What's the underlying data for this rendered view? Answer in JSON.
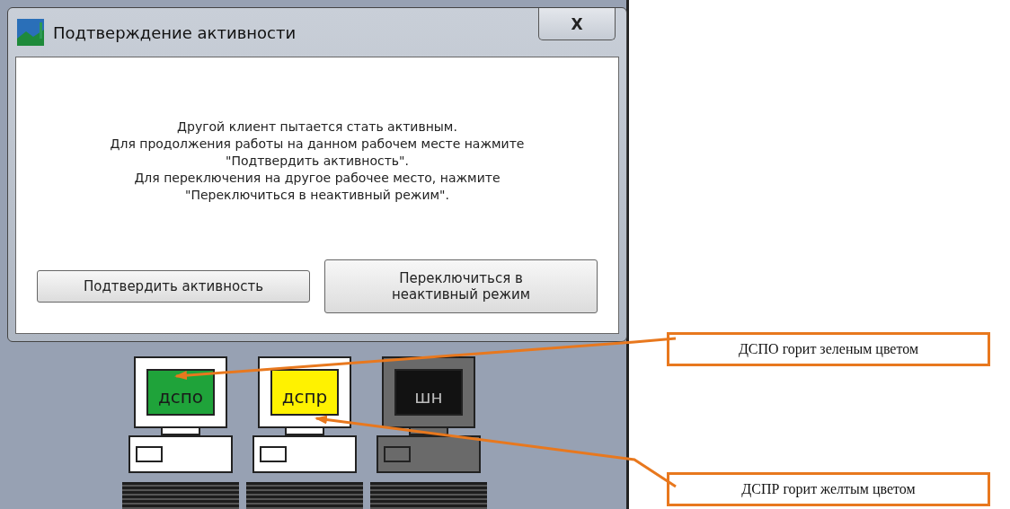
{
  "window": {
    "title": "Подтверждение активности",
    "close_label": "X"
  },
  "message": [
    "Другой клиент пытается стать активным.",
    "Для продолжения работы на данном рабочем месте нажмите",
    "\"Подтвердить активность\".",
    "Для переключения на другое рабочее место, нажмите",
    "\"Переключиться в неактивный режим\"."
  ],
  "buttons": [
    {
      "label": "Подтвердить активность"
    },
    {
      "label": "Переключиться в неактивный режим"
    }
  ],
  "stations": [
    {
      "label": "дспо",
      "color": "#1fa33a",
      "active": true
    },
    {
      "label": "дспр",
      "color": "#fff200",
      "active": true
    },
    {
      "label": "шн",
      "color": "#121212",
      "active": false
    }
  ],
  "callouts": [
    {
      "text": "ДСПО горит зеленым цветом"
    },
    {
      "text": "ДСПР горит желтым цветом"
    }
  ]
}
